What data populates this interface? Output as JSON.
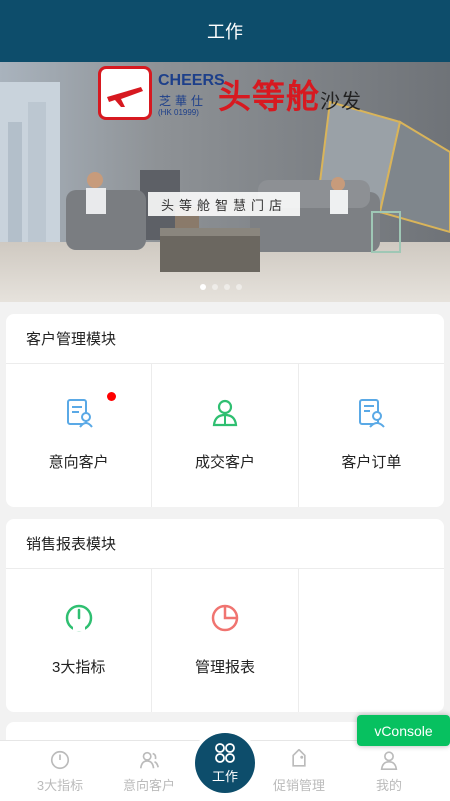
{
  "header": {
    "title": "工作"
  },
  "banner": {
    "brand_logo": "头等舱",
    "brand_mark": "沙发",
    "partner_en": "CHEERS",
    "partner_cn": "芝華仕",
    "partner_code": "(HK 01999)",
    "slogan": "头等舱智慧门店",
    "dots": 4,
    "active_dot": 0
  },
  "customer_module": {
    "title": "客户管理模块",
    "items": [
      {
        "label": "意向客户",
        "icon": "prospect-document-icon",
        "badge": true
      },
      {
        "label": "成交客户",
        "icon": "deal-customer-icon",
        "badge": false
      },
      {
        "label": "客户订单",
        "icon": "customer-order-icon",
        "badge": false
      }
    ]
  },
  "sales_module": {
    "title": "销售报表模块",
    "items": [
      {
        "label": "3大指标",
        "icon": "gauge-icon"
      },
      {
        "label": "管理报表",
        "icon": "pie-chart-icon"
      }
    ]
  },
  "tabbar": {
    "tabs": [
      {
        "label": "3大指标",
        "icon": "gauge-icon"
      },
      {
        "label": "意向客户",
        "icon": "users-icon"
      },
      {
        "label": "工作",
        "icon": "grid-icon",
        "active": true
      },
      {
        "label": "促销管理",
        "icon": "tag-icon"
      },
      {
        "label": "我的",
        "icon": "user-icon"
      }
    ]
  },
  "vconsole": {
    "label": "vConsole"
  },
  "colors": {
    "primary": "#0d4d6b",
    "badge": "#ff0000",
    "vconsole": "#07c160",
    "icon_blue": "#5aa9e6",
    "icon_green": "#2fbf71",
    "icon_red": "#f07470"
  }
}
